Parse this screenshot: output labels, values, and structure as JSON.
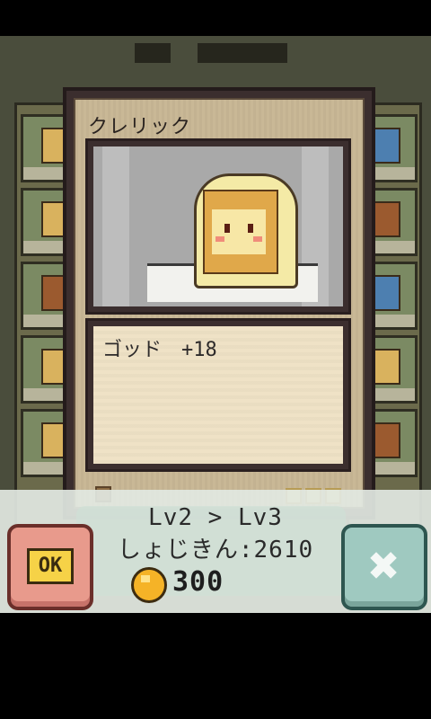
{
  "card": {
    "title": "クレリック",
    "bonus_text": "ゴッド　+18",
    "level_pips": 3
  },
  "upgrade": {
    "level_text": "Lv2 > Lv3",
    "money_text": "しょじきん:2610",
    "cost": "300"
  },
  "buttons": {
    "ok_label": "OK",
    "cancel_symbol": "✖"
  },
  "colors": {
    "ok_button": "#e89a8c",
    "cancel_button": "#9fc9c0",
    "coin": "#f5b327"
  }
}
